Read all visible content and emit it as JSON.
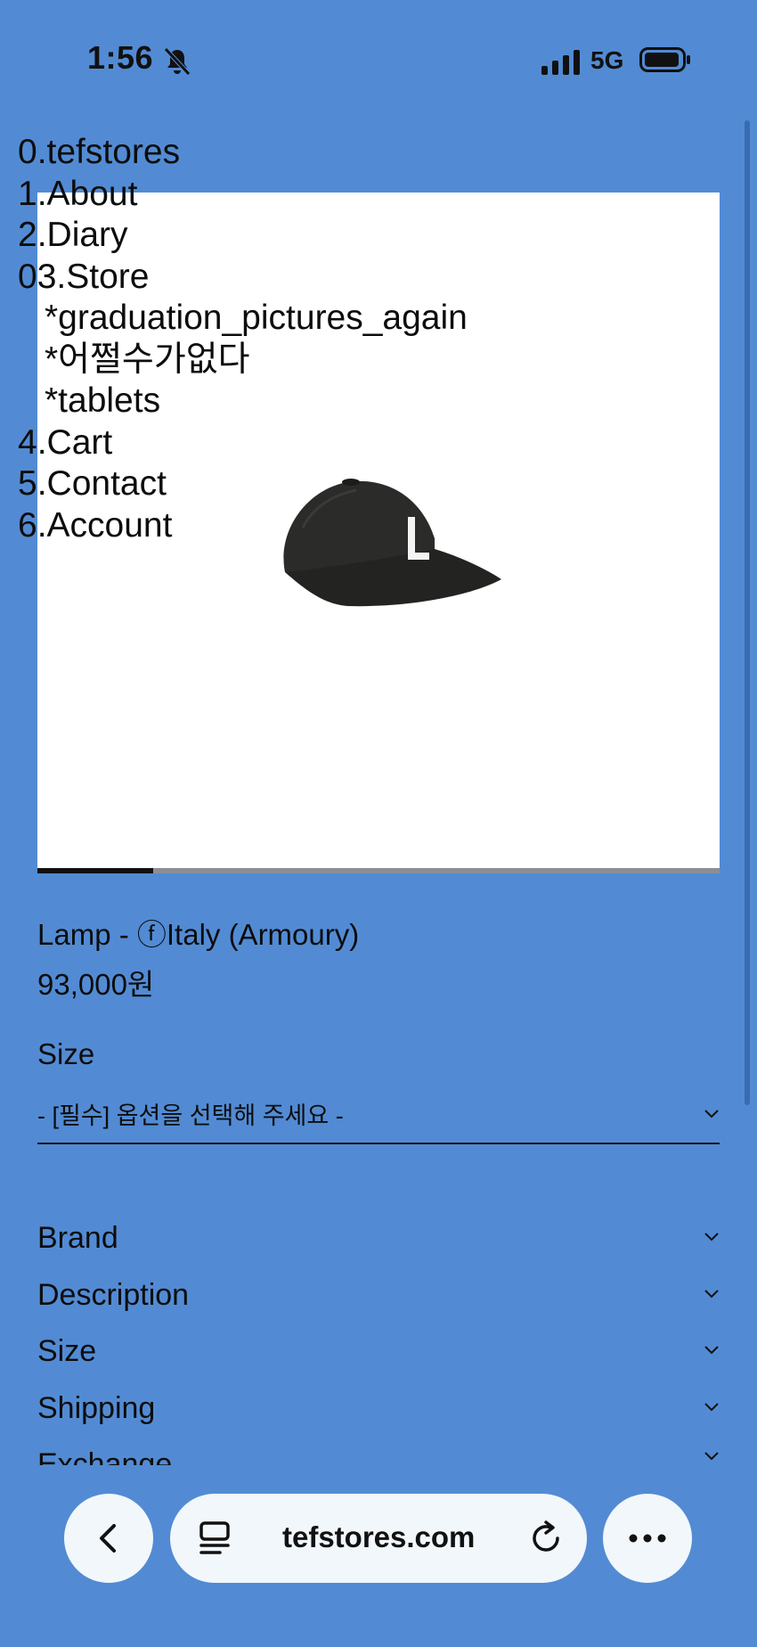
{
  "status_bar": {
    "time": "1:56",
    "network": "5G"
  },
  "nav": {
    "items": [
      {
        "label": "0.tefstores",
        "sub": false
      },
      {
        "label": "1.About",
        "sub": false
      },
      {
        "label": "2.Diary",
        "sub": false
      },
      {
        "label": "03.Store",
        "sub": false
      },
      {
        "label": "*graduation_pictures_again",
        "sub": true
      },
      {
        "label": "*어쩔수가없다",
        "sub": true
      },
      {
        "label": "*tablets",
        "sub": true
      },
      {
        "label": "4.Cart",
        "sub": false
      },
      {
        "label": "5.Contact",
        "sub": false
      },
      {
        "label": "6.Account",
        "sub": false
      }
    ]
  },
  "product": {
    "name": "Lamp - ⓕItaly (Armoury)",
    "price": "93,000원",
    "image_slider_progress": 0.17,
    "size_label": "Size",
    "size_placeholder": "- [필수] 옵션을 선택해 주세요 -"
  },
  "accordions": [
    {
      "label": "Brand"
    },
    {
      "label": "Description"
    },
    {
      "label": "Size"
    },
    {
      "label": "Shipping"
    },
    {
      "label": "Exchange"
    }
  ],
  "browser": {
    "url": "tefstores.com"
  },
  "colors": {
    "background": "#528bd4",
    "pill": "#f2f7fb"
  }
}
